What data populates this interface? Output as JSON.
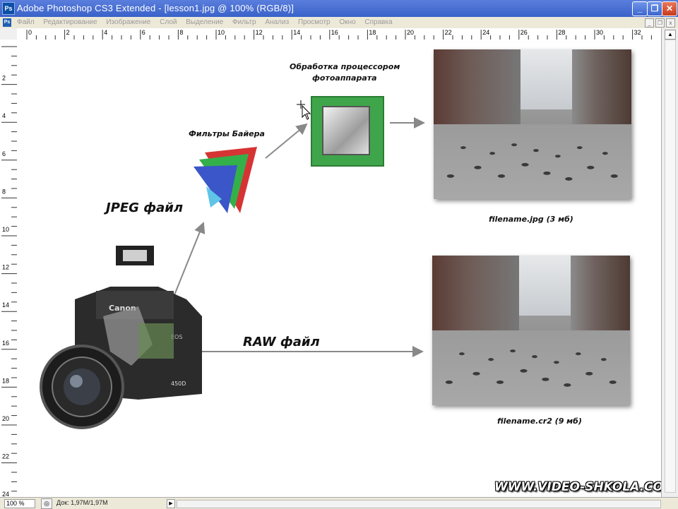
{
  "window": {
    "title": "Adobe Photoshop CS3 Extended - [lesson1.jpg @ 100% (RGB/8)]",
    "app_icon": "Ps",
    "controls": [
      "_",
      "❐",
      "✕"
    ]
  },
  "menu": {
    "items": [
      "Файл",
      "Редактирование",
      "Изображение",
      "Слой",
      "Выделение",
      "Фильтр",
      "Анализ",
      "Просмотр",
      "Окно",
      "Справка"
    ]
  },
  "ruler": {
    "top_ticks": [
      "0",
      "2",
      "4",
      "6",
      "8",
      "10",
      "12",
      "14",
      "16",
      "18",
      "20",
      "22",
      "24",
      "26",
      "28",
      "30",
      "32"
    ],
    "left_ticks": [
      "2",
      "4",
      "6",
      "8",
      "10",
      "12",
      "14",
      "16",
      "18",
      "20",
      "22",
      "24"
    ]
  },
  "diagram": {
    "processor_label_line1": "Обработка процессором",
    "processor_label_line2": "фотоаппарата",
    "bayer_label": "Фильтры Байера",
    "jpeg_label": "JPEG файл",
    "raw_label": "RAW файл",
    "jpg_caption": "filename.jpg (3 мб)",
    "raw_caption": "filename.cr2 (9 мб)",
    "camera_brand": "Canon",
    "camera_model": "450D",
    "camera_badge": "EOS"
  },
  "status": {
    "zoom": "100 %",
    "doc": "Док: 1,97M/1,97M"
  },
  "watermark": "WWW.VIDEO-SHKOLA.COM",
  "colors": {
    "titlebar": "#3a62c9",
    "chip_green": "#3fa54a",
    "arrow": "#888888"
  }
}
